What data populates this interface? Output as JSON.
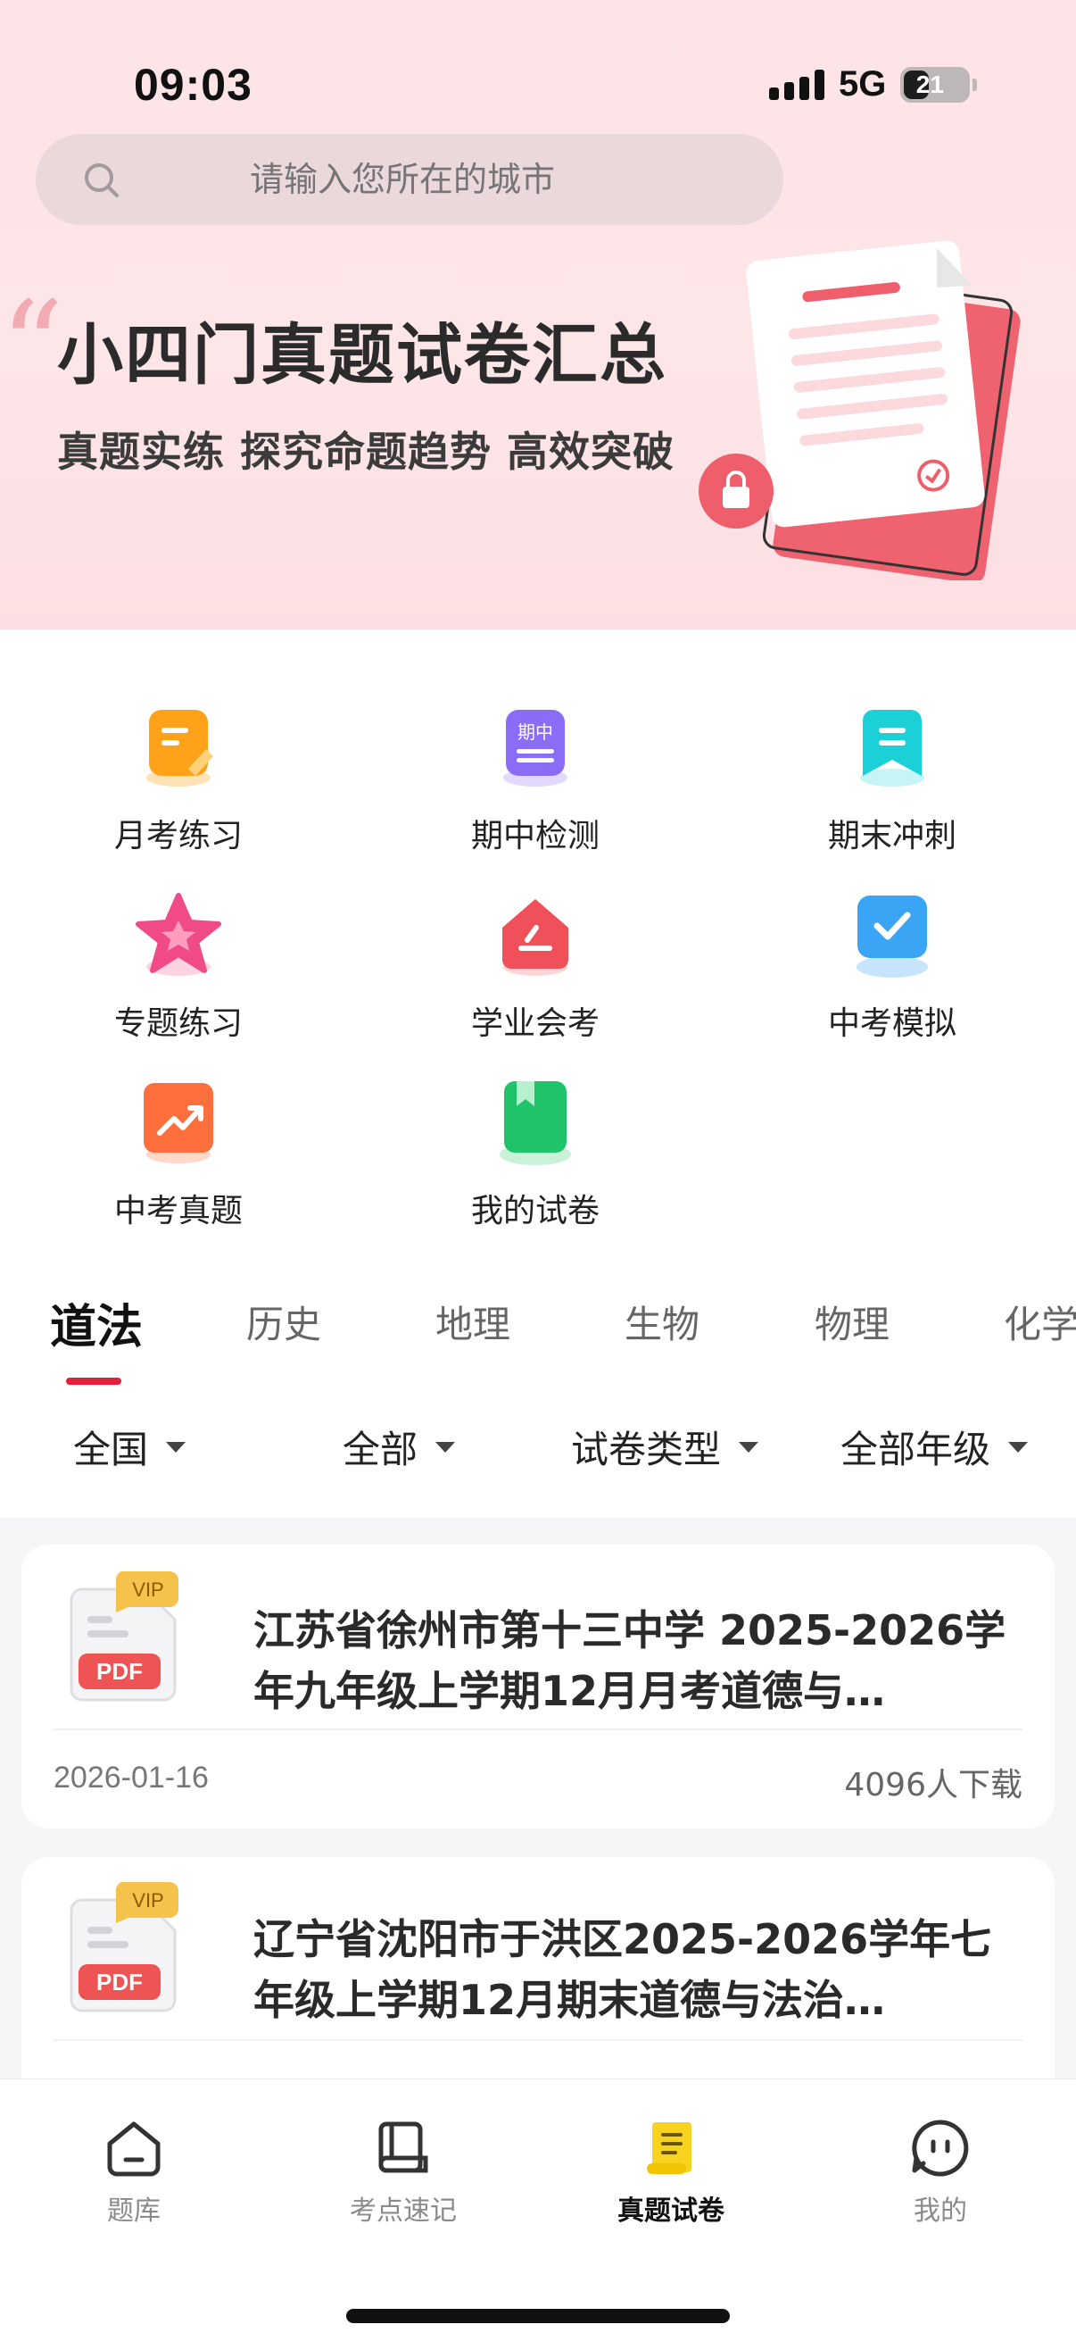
{
  "status_bar": {
    "time": "09:03",
    "network": "5G",
    "battery": "21"
  },
  "search": {
    "placeholder": "请输入您所在的城市"
  },
  "banner": {
    "title": "小四门真题试卷汇总",
    "subtitle": "真题实练 探究命题趋势 高效突破"
  },
  "categories": [
    {
      "label": "月考练习",
      "icon": "monthly-exam-icon",
      "color": "#ffa21a"
    },
    {
      "label": "期中检测",
      "icon": "midterm-icon",
      "icon_text": "期中",
      "color": "#8a6cf6"
    },
    {
      "label": "期末冲刺",
      "icon": "final-sprint-icon",
      "color": "#1cd0d8"
    },
    {
      "label": "专题练习",
      "icon": "star-icon",
      "color": "#f04b86"
    },
    {
      "label": "学业会考",
      "icon": "academic-exam-icon",
      "color": "#f0505a"
    },
    {
      "label": "中考模拟",
      "icon": "mock-exam-icon",
      "color": "#3aa4f5"
    },
    {
      "label": "中考真题",
      "icon": "trend-icon",
      "color": "#ff6f3d"
    },
    {
      "label": "我的试卷",
      "icon": "bookmark-book-icon",
      "color": "#1fc46a"
    }
  ],
  "subject_tabs": [
    {
      "label": "道法",
      "active": true
    },
    {
      "label": "历史",
      "active": false
    },
    {
      "label": "地理",
      "active": false
    },
    {
      "label": "生物",
      "active": false
    },
    {
      "label": "物理",
      "active": false
    },
    {
      "label": "化学",
      "active": false
    }
  ],
  "filters": [
    {
      "label": "全国"
    },
    {
      "label": "全部"
    },
    {
      "label": "试卷类型"
    },
    {
      "label": "全部年级"
    }
  ],
  "papers": [
    {
      "badge": "VIP",
      "file_type": "PDF",
      "title": "江苏省徐州市第十三中学 2025-2026学年九年级上学期12月月考道德与…",
      "date": "2026-01-16",
      "downloads": "4096人下载"
    },
    {
      "badge": "VIP",
      "file_type": "PDF",
      "title": "辽宁省沈阳市于洪区2025-2026学年七年级上学期12月期末道德与法治…",
      "date": "",
      "downloads": ""
    }
  ],
  "bottom_nav": [
    {
      "label": "题库",
      "icon": "home-icon",
      "active": false
    },
    {
      "label": "考点速记",
      "icon": "book-icon",
      "active": false
    },
    {
      "label": "真题试卷",
      "icon": "scroll-icon",
      "active": true
    },
    {
      "label": "我的",
      "icon": "profile-face-icon",
      "active": false
    }
  ],
  "colors": {
    "accent": "#e2213a",
    "hero_bg": "#fde3e6",
    "vip": "#f5c34b",
    "pdf": "#ef5454"
  }
}
